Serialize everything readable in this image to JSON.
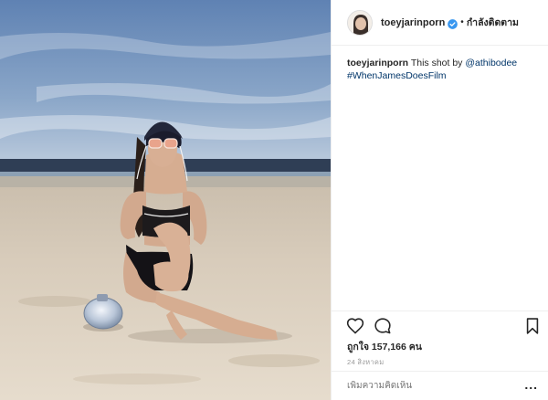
{
  "post": {
    "username": "toeyjarinporn",
    "follow_status": "กำลังติดตาม",
    "caption_user": "toeyjarinporn",
    "caption_text": " This shot by ",
    "caption_mention": "@athibodee",
    "caption_hashtag": "#WhenJamesDoesFilm",
    "likes_text": "ถูกใจ 157,166 คน",
    "date": "24 สิงหาคม",
    "comment_placeholder": "เพิ่มความคิดเห็น",
    "more_label": "..."
  },
  "colors": {
    "sky": "#6f8fb8",
    "sea": "#3a4a5e",
    "sand": "#d9cbb8",
    "link": "#003569",
    "verified": "#3897f0"
  },
  "icons": {
    "like": "heart-icon",
    "comment": "comment-icon",
    "save": "bookmark-icon",
    "verified": "verified-badge-icon"
  }
}
